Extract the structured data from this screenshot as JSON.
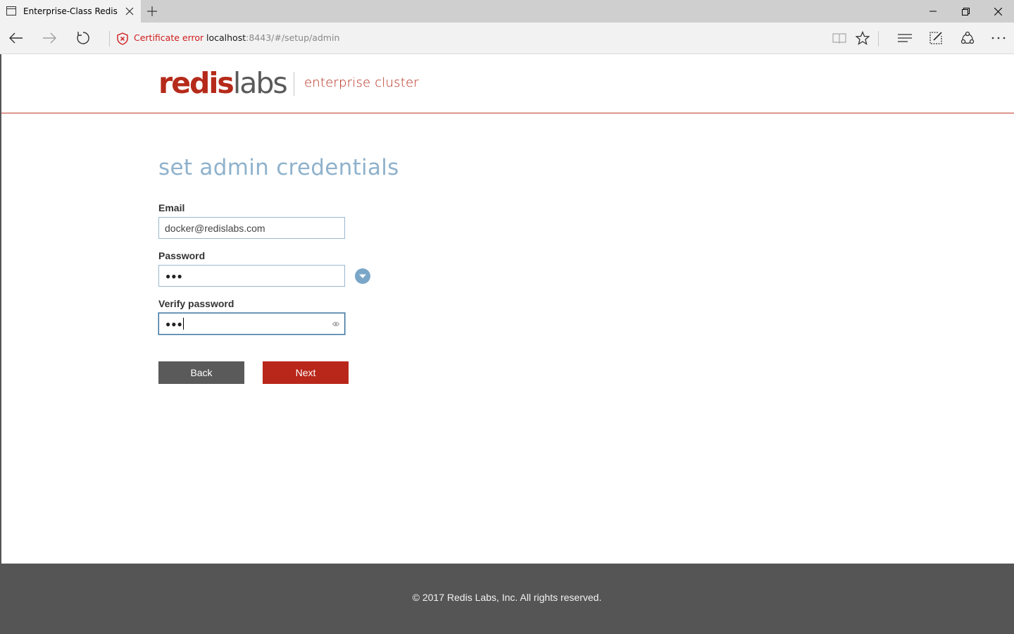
{
  "browser": {
    "tab_title": "Enterprise-Class Redis fo",
    "new_tab_symbol": "+",
    "cert_error": "Certificate error",
    "url_host": "localhost",
    "url_rest": ":8443/#/setup/admin"
  },
  "header": {
    "logo_redis": "redis",
    "logo_labs": "labs",
    "product": "enterprise cluster"
  },
  "form": {
    "title": "set admin credentials",
    "email_label": "Email",
    "email_value": "docker@redislabs.com",
    "password_label": "Password",
    "password_mask": "●●●",
    "verify_label": "Verify password",
    "verify_mask": "●●●",
    "back_label": "Back",
    "next_label": "Next"
  },
  "footer": {
    "copyright": "© 2017 Redis Labs, Inc. All rights reserved."
  },
  "colors": {
    "brand_red": "#b8271a",
    "heading_blue": "#8fb2cc",
    "footer_gray": "#555555"
  },
  "icons": [
    "page-icon",
    "close-icon",
    "plus-icon",
    "minimize-icon",
    "restore-icon",
    "back-arrow-icon",
    "forward-arrow-icon",
    "refresh-icon",
    "shield-error-icon",
    "reading-view-icon",
    "star-icon",
    "hub-icon",
    "web-note-icon",
    "share-icon",
    "more-icon",
    "chevron-down-icon",
    "reveal-password-icon"
  ]
}
